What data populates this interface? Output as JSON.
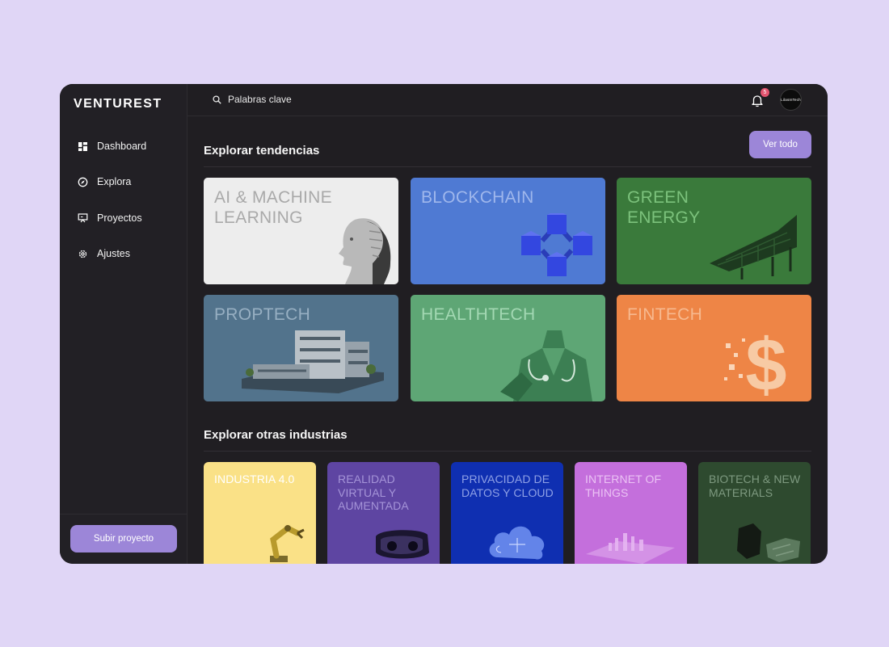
{
  "app": {
    "logo": "VENTUREST"
  },
  "sidebar": {
    "items": [
      {
        "label": "Dashboard",
        "icon": "dashboard-icon"
      },
      {
        "label": "Explora",
        "icon": "compass-icon"
      },
      {
        "label": "Proyectos",
        "icon": "presentation-icon"
      },
      {
        "label": "Ajustes",
        "icon": "gear-icon"
      }
    ],
    "upload_label": "Subir proyecto"
  },
  "topbar": {
    "search_placeholder": "Palabras clave",
    "notifications_count": "5",
    "avatar_text": "LilasInTech"
  },
  "trends": {
    "title": "Explorar tendencias",
    "view_all": "Ver todo",
    "cards": [
      {
        "label": "AI & MACHINE LEARNING",
        "bg": "#ededed",
        "fg": "#a9a9a9"
      },
      {
        "label": "BLOCKCHAIN",
        "bg": "#4f7ad3",
        "fg": "#9fb7ec"
      },
      {
        "label": "GREEN ENERGY",
        "bg": "#3a7a3b",
        "fg": "#7cc27c"
      },
      {
        "label": "PROPTECH",
        "bg": "#52738c",
        "fg": "#97afc2"
      },
      {
        "label": "HEALTHTECH",
        "bg": "#5ea675",
        "fg": "#a3d8b3"
      },
      {
        "label": "FINTECH",
        "bg": "#ee8546",
        "fg": "#f7b98f"
      }
    ]
  },
  "industries": {
    "title": "Explorar otras industrias",
    "cards": [
      {
        "label": "INDUSTRIA 4.0",
        "bg": "#fae187",
        "fg": "#ffffff"
      },
      {
        "label": "REALIDAD VIRTUAL Y AUMENTADA",
        "bg": "#5e45a2",
        "fg": "#a594d8"
      },
      {
        "label": "PRIVACIDAD DE DATOS Y CLOUD",
        "bg": "#0f2fb1",
        "fg": "#8fa1e6"
      },
      {
        "label": "INTERNET OF THINGS",
        "bg": "#c46fdc",
        "fg": "#ebc2f4"
      },
      {
        "label": "BIOTECH & NEW MATERIALS",
        "bg": "#2e4a2f",
        "fg": "#7e9a80"
      }
    ]
  }
}
